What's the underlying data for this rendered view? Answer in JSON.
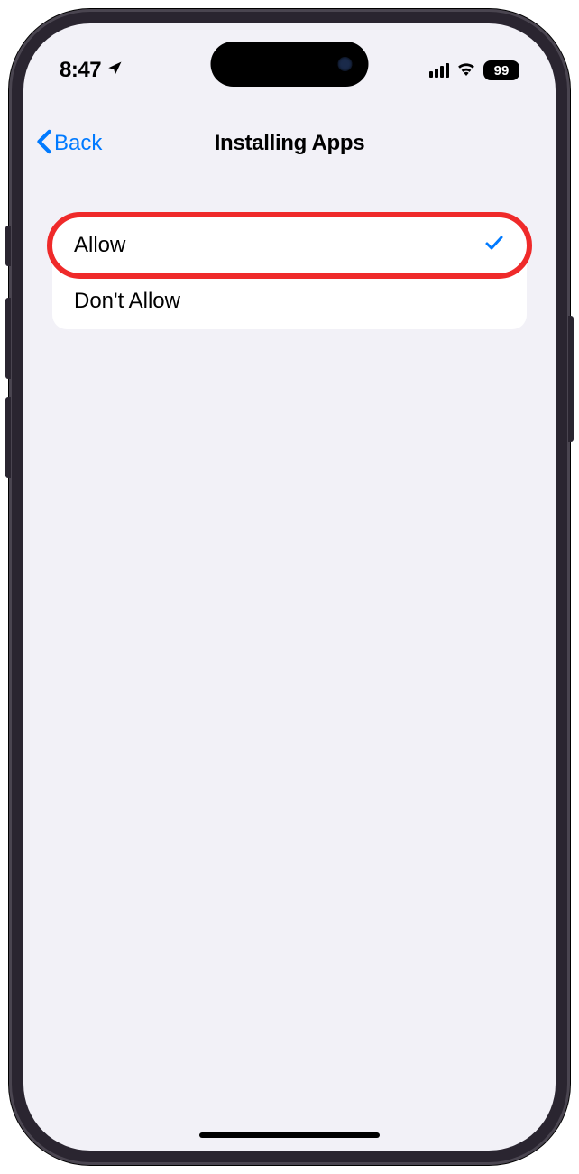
{
  "status": {
    "time": "8:47",
    "battery_level": "99"
  },
  "nav": {
    "back_label": "Back",
    "title": "Installing Apps"
  },
  "options": [
    {
      "label": "Allow",
      "selected": true,
      "highlighted": true
    },
    {
      "label": "Don't Allow",
      "selected": false,
      "highlighted": false
    }
  ]
}
